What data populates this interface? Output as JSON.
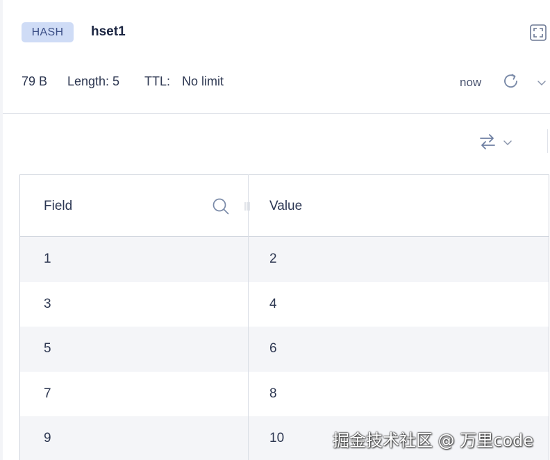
{
  "header": {
    "type_badge": "HASH",
    "key_name": "hset1",
    "size": "79 B",
    "length": "Length: 5",
    "ttl_label": "TTL:",
    "ttl_value": "No limit",
    "last_refresh": "now"
  },
  "icons": {
    "fullscreen": "fullscreen-icon",
    "refresh": "refresh-icon",
    "chevron": "chevron-down-icon",
    "format": "swap-arrows-icon",
    "search": "search-icon",
    "resize": "column-resize-icon"
  },
  "table": {
    "columns": [
      "Field",
      "Value"
    ],
    "rows": [
      {
        "field": "1",
        "value": "2"
      },
      {
        "field": "3",
        "value": "4"
      },
      {
        "field": "5",
        "value": "6"
      },
      {
        "field": "7",
        "value": "8"
      },
      {
        "field": "9",
        "value": "10"
      }
    ]
  },
  "watermark": "掘金技术社区 @ 万里code",
  "colors": {
    "badge_bg": "#cfdcf6",
    "badge_text": "#3b4e86",
    "row_alt": "#f4f5f8",
    "border": "#cfd4dd",
    "icon": "#7a8aa8"
  }
}
